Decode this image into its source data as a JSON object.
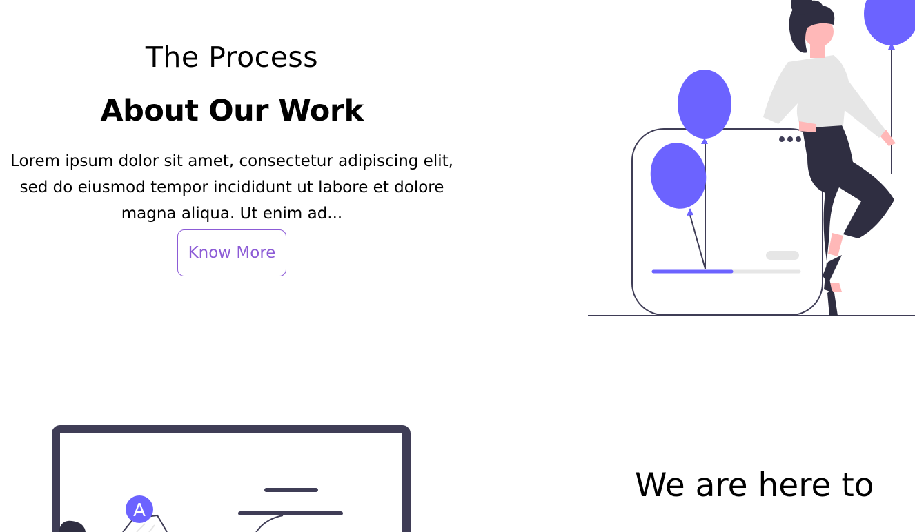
{
  "about": {
    "eyebrow": "The Process",
    "heading": "About Our Work",
    "body_line_1": "Lorem ipsum dolor sit amet, consectetur adipiscing elit,",
    "body_line_2": "sed do eiusmod tempor incididunt ut labore et dolore",
    "body_line_3": "magna aliqua. Ut enim ad...",
    "button_label": "Know More"
  },
  "next_section": {
    "heading": "We are here to"
  },
  "illustrations": {
    "top": "woman-with-balloons-illustration",
    "bottom": "presentation-board-illustration",
    "avatar_letter": "A"
  },
  "colors": {
    "accent": "#6c63ff",
    "button": "#8c5bd6",
    "dark": "#2f2e41",
    "light_gray": "#e6e6e6",
    "skin": "#ffb8b8"
  }
}
